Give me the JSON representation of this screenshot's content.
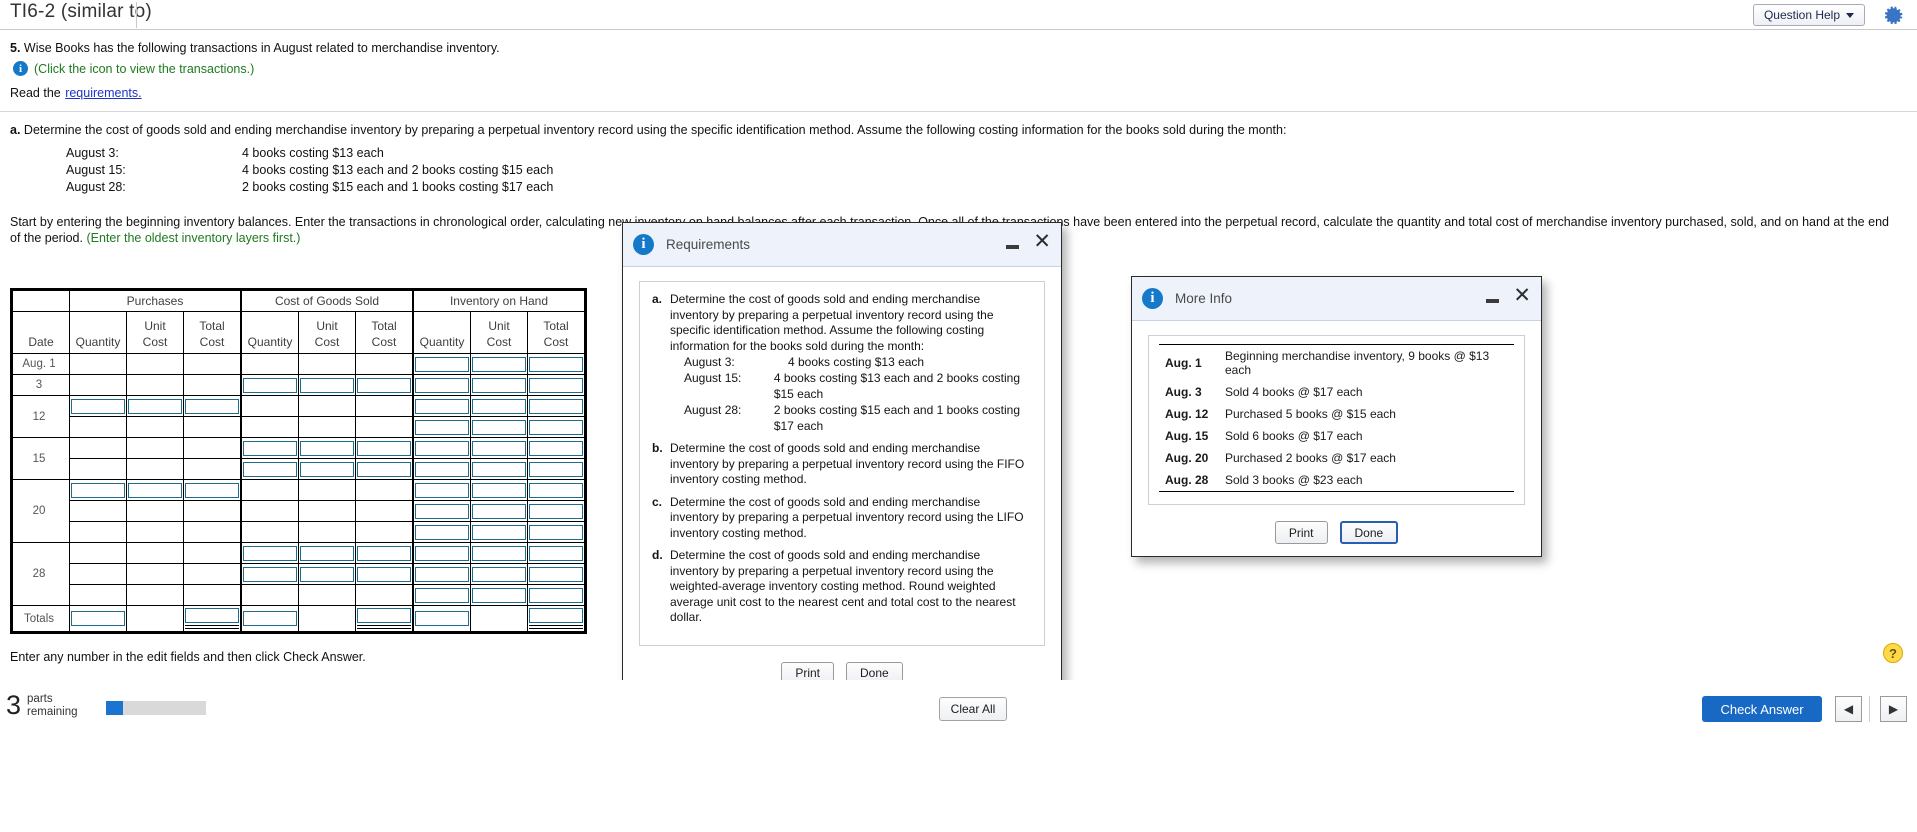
{
  "topbar": {
    "question_title": "TI6-2 (similar to)",
    "question_help_label": "Question Help",
    "settings_icon": "gear-icon"
  },
  "question": {
    "number": "5.",
    "stem": "Wise Books has the following transactions in August related to merchandise inventory.",
    "click_icon_note": "(Click the icon to view the transactions.)",
    "read_the": "Read the",
    "requirements_link": "requirements.",
    "part_a_label": "a.",
    "part_a_text": "Determine the cost of goods sold and ending merchandise inventory by preparing a perpetual inventory record using the specific identification method. Assume the following costing information for the books sold during the month:",
    "costing_rows": [
      {
        "date": "August 3:",
        "detail": "4 books costing $13 each"
      },
      {
        "date": "August 15:",
        "detail": "4 books costing $13 each and 2 books costing $15 each"
      },
      {
        "date": "August 28:",
        "detail": "2 books costing $15 each and 1 books costing $17 each"
      }
    ],
    "instruction": "Start by entering the beginning inventory balances. Enter the transactions in chronological order, calculating new inventory on hand balances after each transaction. Once all of the transactions have been entered into the perpetual record, calculate the quantity and total cost of merchandise inventory purchased, sold, and on hand at the end of the period.",
    "instruction_green": "(Enter the oldest inventory layers first.)"
  },
  "perpetual_table": {
    "group_headers": [
      "",
      "Purchases",
      "Cost of Goods Sold",
      "Inventory on Hand"
    ],
    "sub_headers": {
      "date": "Date",
      "quantity": "Quantity",
      "unit_cost_l1": "Unit",
      "unit_cost_l2": "Cost",
      "total_cost_l1": "Total",
      "total_cost_l2": "Cost"
    },
    "rows": [
      {
        "date": "Aug. 1",
        "lines": 1,
        "purchases": [
          false
        ],
        "cogs": [
          false
        ],
        "onhand": [
          true
        ]
      },
      {
        "date": "3",
        "lines": 1,
        "purchases": [
          false
        ],
        "cogs": [
          true
        ],
        "onhand": [
          true
        ]
      },
      {
        "date": "12",
        "lines": 2,
        "purchases": [
          true,
          false
        ],
        "cogs": [
          false,
          false
        ],
        "onhand": [
          true,
          true
        ]
      },
      {
        "date": "15",
        "lines": 2,
        "purchases": [
          false,
          false
        ],
        "cogs": [
          true,
          true
        ],
        "onhand": [
          true,
          true
        ]
      },
      {
        "date": "20",
        "lines": 3,
        "purchases": [
          true,
          false,
          false
        ],
        "cogs": [
          false,
          false,
          false
        ],
        "onhand": [
          true,
          true,
          true
        ]
      },
      {
        "date": "28",
        "lines": 3,
        "purchases": [
          false,
          false,
          false
        ],
        "cogs": [
          true,
          true,
          false
        ],
        "onhand": [
          true,
          true,
          true
        ]
      }
    ],
    "totals_label": "Totals"
  },
  "requirements_dialog": {
    "title": "Requirements",
    "icon": "info-icon",
    "minimize": "minimize-icon",
    "close": "close-icon",
    "items": [
      {
        "bullet": "a.",
        "text": "Determine the cost of goods sold and ending merchandise inventory by preparing a perpetual inventory record using the specific identification method. Assume the following costing information for the books sold during the month:",
        "sub": [
          {
            "date": "August 3:",
            "detail": "4 books costing $13 each"
          },
          {
            "date": "August 15:",
            "detail": "4 books costing $13 each and 2 books costing $15 each"
          },
          {
            "date": "August 28:",
            "detail": "2 books costing $15 each and 1 books costing $17 each"
          }
        ]
      },
      {
        "bullet": "b.",
        "text": "Determine the cost of goods sold and ending merchandise inventory by preparing a perpetual inventory record using the FIFO inventory costing method.",
        "sub": []
      },
      {
        "bullet": "c.",
        "text": "Determine the cost of goods sold and ending merchandise inventory by preparing a perpetual inventory record using the LIFO inventory costing method.",
        "sub": []
      },
      {
        "bullet": "d.",
        "text": "Determine the cost of goods sold and ending merchandise inventory by preparing a perpetual inventory record using the weighted-average inventory costing method. Round weighted average unit cost to the nearest cent and total cost to the nearest dollar.",
        "sub": []
      }
    ],
    "print_label": "Print",
    "done_label": "Done"
  },
  "more_info_dialog": {
    "title": "More Info",
    "icon": "info-icon",
    "minimize": "minimize-icon",
    "close": "close-icon",
    "rows": [
      {
        "date": "Aug. 1",
        "detail": "Beginning merchandise inventory, 9 books @ $13 each"
      },
      {
        "date": "Aug. 3",
        "detail": "Sold 4 books @ $17 each"
      },
      {
        "date": "Aug. 12",
        "detail": "Purchased 5 books @ $15 each"
      },
      {
        "date": "Aug. 15",
        "detail": "Sold 6 books @ $17 each"
      },
      {
        "date": "Aug. 20",
        "detail": "Purchased 2 books @ $17 each"
      },
      {
        "date": "Aug. 28",
        "detail": "Sold 3 books @ $23 each"
      }
    ],
    "print_label": "Print",
    "done_label": "Done"
  },
  "footer": {
    "note": "Enter any number in the edit fields and then click Check Answer.",
    "help_icon": "?",
    "parts_count": "3",
    "parts_word_1": "parts",
    "parts_word_2": "remaining",
    "progress_percent": 17,
    "clear_all_label": "Clear All",
    "check_answer_label": "Check Answer",
    "prev_label": "◀",
    "next_label": "▶"
  }
}
